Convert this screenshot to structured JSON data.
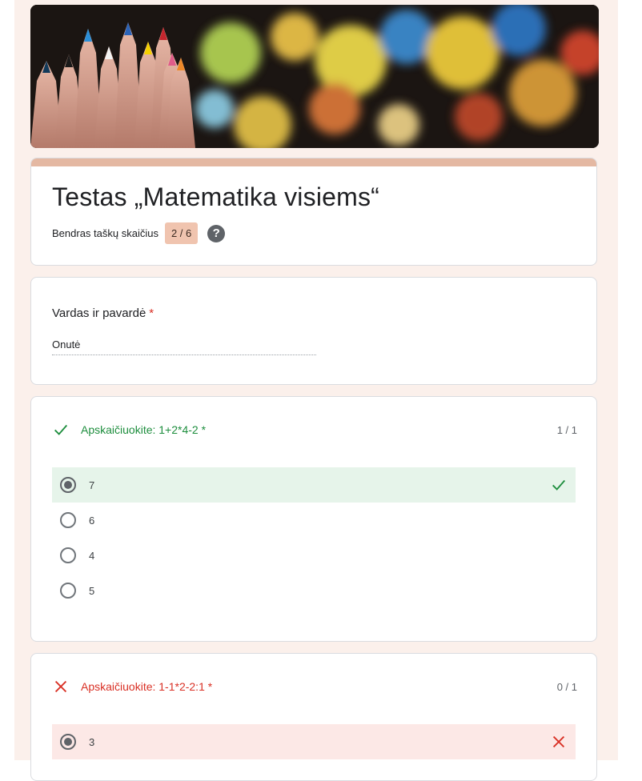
{
  "form": {
    "title": "Testas „Matematika visiems“",
    "score_label": "Bendras taškų skaičius",
    "score_value": "2 / 6",
    "help_icon": "help-circle-icon"
  },
  "name_question": {
    "label": "Vardas ir pavardė",
    "required_mark": "*",
    "answer": "Onutė"
  },
  "questions": [
    {
      "title": "Apskaičiuokite: 1+2*4-2",
      "required_mark": "*",
      "points": "1 / 1",
      "status": "correct",
      "status_icon": "checkmark-icon",
      "options": [
        "7",
        "6",
        "4",
        "5"
      ],
      "selected": "7"
    },
    {
      "title": "Apskaičiuokite: 1-1*2-2:1",
      "required_mark": "*",
      "points": "0 / 1",
      "status": "incorrect",
      "status_icon": "cross-icon",
      "options": [
        "3"
      ],
      "selected": "3"
    }
  ],
  "colors": {
    "page_background": "#fbf0eb",
    "accent": "#e4b8a2",
    "correct": "#1e8e3e",
    "incorrect": "#d93025",
    "score_badge": "#f0c4af"
  },
  "banner": {
    "image": "colored-pencils-bokeh"
  }
}
